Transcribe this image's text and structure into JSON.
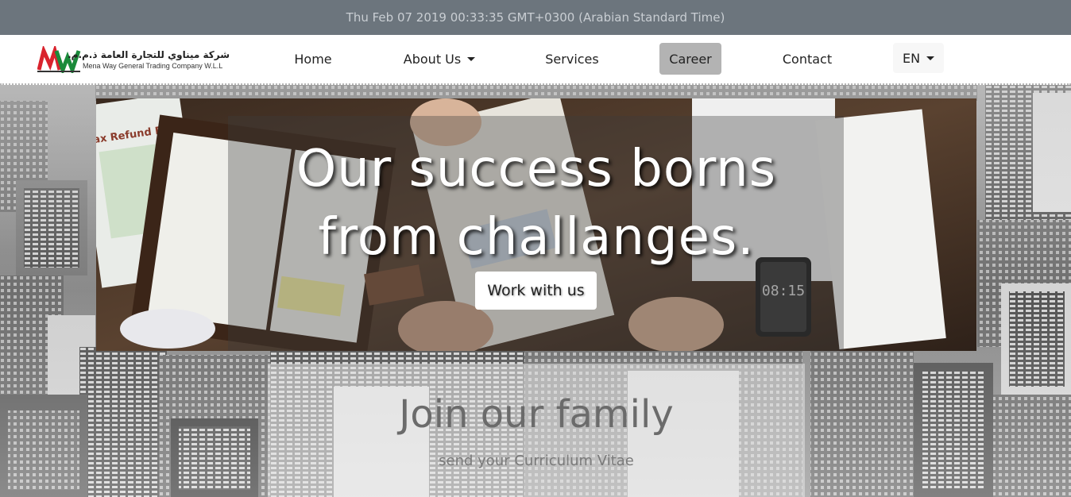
{
  "datebar": {
    "text": "Thu Feb 07 2019 00:33:35 GMT+0300 (Arabian Standard Time)"
  },
  "logo": {
    "mark": "MW",
    "arabic_name": "شركة ميناوي للتجارة العامة ذ.م.م.",
    "english_name": "Mena Way General Trading Company W.L.L",
    "colors": {
      "red": "#d9232d",
      "green": "#1a8a3a",
      "dark": "#333333"
    }
  },
  "nav": {
    "items": [
      {
        "label": "Home"
      },
      {
        "label": "About Us"
      },
      {
        "label": "Services"
      },
      {
        "label": "Career"
      },
      {
        "label": "Contact"
      }
    ],
    "active": "Career",
    "language": "EN"
  },
  "hero": {
    "title_line1": "Our success borns",
    "title_line2": "from challanges.",
    "button_label": "Work with us",
    "phone_time": "08:15",
    "refund_form_text": "ax Refund Form"
  },
  "join": {
    "title": "Join our family",
    "subtitle": "send your Curriculum Vitae"
  },
  "colors": {
    "datebar_bg": "#6c757d",
    "datebar_text": "#c9ced3",
    "active_nav_bg": "#b3b3b3"
  }
}
